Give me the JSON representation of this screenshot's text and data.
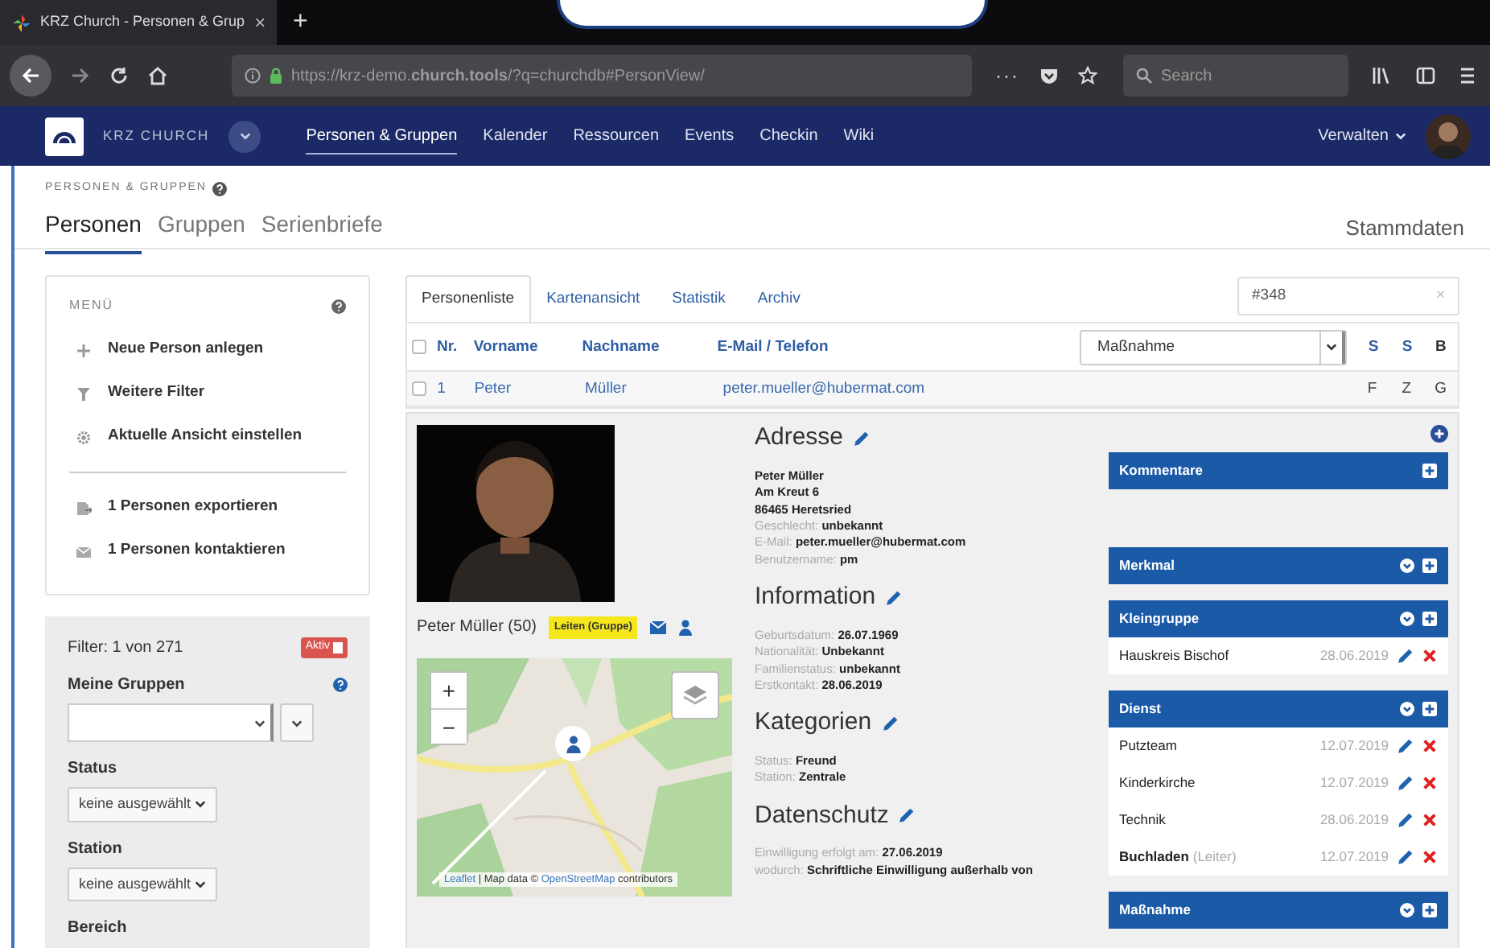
{
  "browser": {
    "tab_title": "KRZ Church - Personen & Grup",
    "tab_close": "×",
    "new_tab": "+",
    "url": "https://krz-demo.**church.tools**/?q=churchdb#PersonView/",
    "page_actions": "···",
    "search_placeholder": "Search"
  },
  "navbar": {
    "brand": "KRZ CHURCH",
    "links": [
      {
        "label": "Personen & Gruppen",
        "selected": true
      },
      {
        "label": "Kalender",
        "selected": false
      },
      {
        "label": "Ressourcen",
        "selected": false
      },
      {
        "label": "Events",
        "selected": false
      },
      {
        "label": "Checkin",
        "selected": false
      },
      {
        "label": "Wiki",
        "selected": false
      }
    ],
    "admin_menu": "Verwalten"
  },
  "header": {
    "section": "PERSONEN & GRUPPEN",
    "tabs": [
      {
        "label": "Personen",
        "selected": true
      },
      {
        "label": "Gruppen",
        "selected": false
      },
      {
        "label": "Serienbriefe",
        "selected": false
      }
    ],
    "link": "Stammdaten"
  },
  "menu": {
    "title": "MENÜ",
    "groups": [
      [
        "Neue Person anlegen",
        "Weitere Filter",
        "Aktuelle Ansicht einstellen"
      ],
      [
        "1 Personen exportieren",
        "1 Personen kontaktieren"
      ]
    ]
  },
  "filter": {
    "summary": "Filter: 1 von 271",
    "badge": "Aktiv",
    "fields": [
      {
        "kind": "combo",
        "label": "Meine Gruppen"
      },
      {
        "kind": "dropdown",
        "label": "Status",
        "value": "keine ausgewählt"
      },
      {
        "kind": "dropdown",
        "label": "Station",
        "value": "keine ausgewählt"
      },
      {
        "kind": "heading",
        "label": "Bereich"
      }
    ]
  },
  "view_tabs": [
    {
      "label": "Personenliste",
      "selected": true
    },
    {
      "label": "Kartenansicht",
      "selected": false
    },
    {
      "label": "Statistik",
      "selected": false
    },
    {
      "label": "Archiv",
      "selected": false
    }
  ],
  "quick_search": {
    "value": "#348",
    "clear": "×"
  },
  "table": {
    "header_checked": false,
    "columns": [
      {
        "label": "Nr.",
        "sortable": true
      },
      {
        "label": "Vorname",
        "sortable": true
      },
      {
        "label": "Nachname",
        "sortable": true
      },
      {
        "label": "E-Mail / Telefon",
        "sortable": true
      }
    ],
    "column_select": "Maßnahme",
    "flag_columns": [
      {
        "label": "S",
        "sortable": true
      },
      {
        "label": "S",
        "sortable": true
      },
      {
        "label": "B",
        "sortable": false
      }
    ],
    "rows": [
      {
        "checked": false,
        "cells": [
          "1",
          "Peter",
          "Müller",
          "peter.mueller@hubermat.com"
        ],
        "flags": [
          "F",
          "Z",
          "G"
        ]
      }
    ]
  },
  "person": {
    "name": "Peter Müller (50)",
    "badge": "Leiten (Gruppe)",
    "map": {
      "zoom_in": "+",
      "zoom_out": "−",
      "attribution": [
        {
          "text": "Leaflet",
          "link": true
        },
        {
          "text": " | Map data © ",
          "link": false
        },
        {
          "text": "OpenStreetMap",
          "link": true
        },
        {
          "text": " contributors",
          "link": false
        }
      ]
    }
  },
  "details": [
    {
      "title": "Adresse",
      "lines": [
        {
          "value": "Peter Müller"
        },
        {
          "value": "Am Kreut 6"
        },
        {
          "value": "86465 Heretsried"
        },
        {
          "label": "Geschlecht:",
          "value": "unbekannt"
        },
        {
          "label": "E-Mail:",
          "value": "peter.mueller@hubermat.com"
        },
        {
          "label": "Benutzername:",
          "value": "pm"
        }
      ]
    },
    {
      "title": "Information",
      "lines": [
        {
          "label": "Geburtsdatum:",
          "value": "26.07.1969"
        },
        {
          "label": "Nationalität:",
          "value": "Unbekannt"
        },
        {
          "label": "Familienstatus:",
          "value": "unbekannt"
        },
        {
          "label": "Erstkontakt:",
          "value": "28.06.2019"
        }
      ]
    },
    {
      "title": "Kategorien",
      "lines": [
        {
          "label": "Status:",
          "value": "Freund"
        },
        {
          "label": "Station:",
          "value": "Zentrale"
        }
      ]
    },
    {
      "title": "Datenschutz",
      "lines": [
        {
          "label": "Einwilligung erfolgt am:",
          "value": "27.06.2019"
        },
        {
          "label": "wodurch:",
          "value": "Schriftliche Einwilligung außerhalb von"
        }
      ]
    }
  ],
  "panels": [
    {
      "kind": "comments",
      "title": "Kommentare"
    },
    {
      "kind": "list",
      "title": "Merkmal"
    },
    {
      "kind": "list",
      "title": "Kleingruppe",
      "items": [
        {
          "name": "Hauskreis Bischof",
          "date": "28.06.2019"
        }
      ]
    },
    {
      "kind": "list",
      "title": "Dienst",
      "items": [
        {
          "name": "Putzteam",
          "date": "12.07.2019"
        },
        {
          "name": "Kinderkirche",
          "date": "12.07.2019"
        },
        {
          "name": "Technik",
          "date": "28.06.2019"
        },
        {
          "name": "Buchladen",
          "note": "(Leiter)",
          "date": "12.07.2019"
        }
      ]
    },
    {
      "kind": "list",
      "title": "Maßnahme"
    }
  ]
}
